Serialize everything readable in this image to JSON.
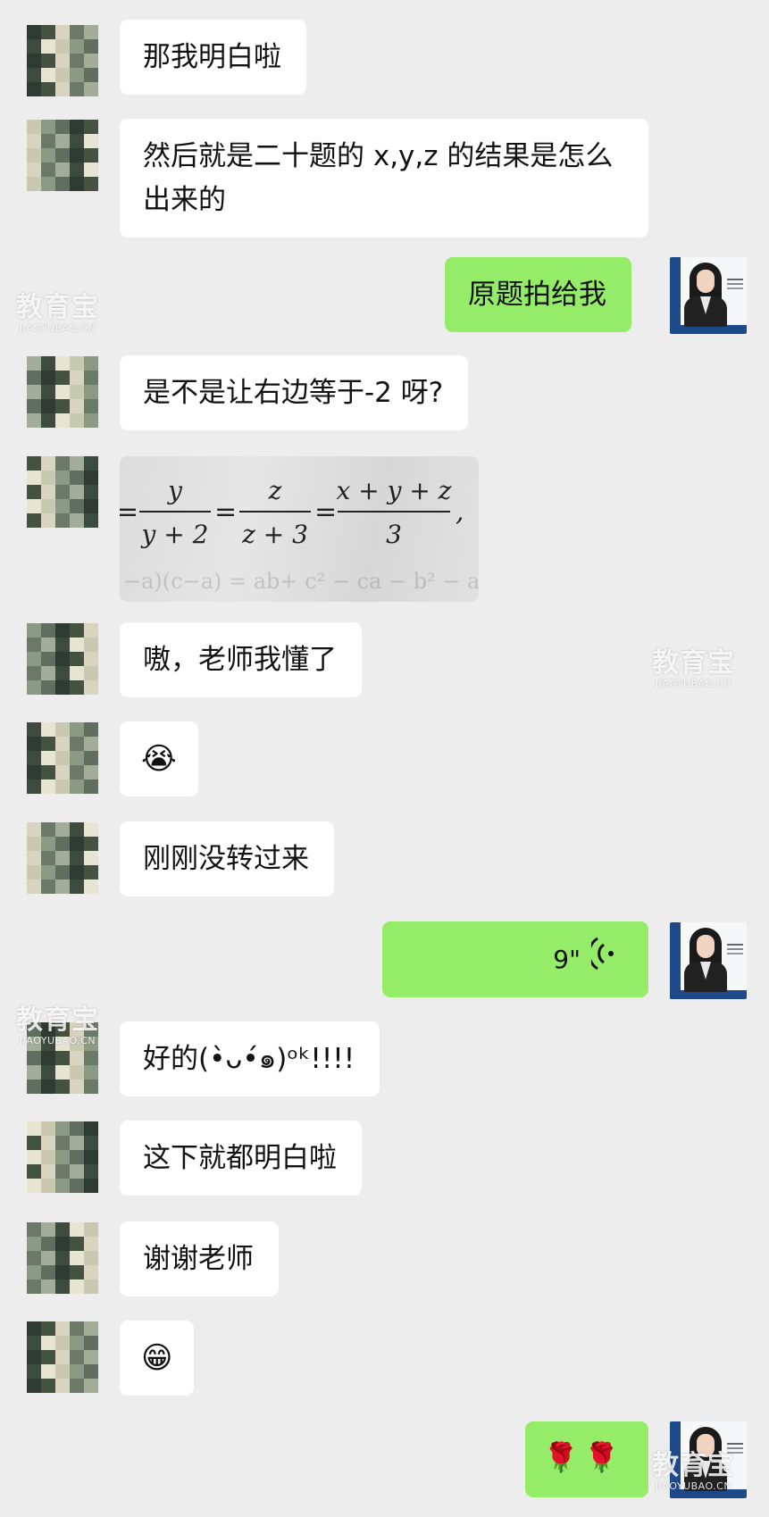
{
  "messages": [
    {
      "text": "那我明白啦"
    },
    {
      "text": "然后就是二十题的 x,y,z 的结果是怎么出来的"
    },
    {
      "text": "原题拍给我"
    },
    {
      "text": "是不是让右边等于-2 呀?"
    },
    {
      "text": "嗷，老师我懂了"
    },
    {
      "text": "😭"
    },
    {
      "text": "刚刚没转过来"
    },
    {
      "voice_duration": "9\""
    },
    {
      "text": "好的(•̀ᴗ•́๑)ᵒᵏ!!!!"
    },
    {
      "text": "这下就都明白啦"
    },
    {
      "text": "谢谢老师"
    },
    {
      "text": "😁"
    },
    {
      "text": "🌹🌹"
    }
  ],
  "math_image": {
    "frac1_num": "y",
    "frac1_den": "y + 2",
    "frac2_num": "z",
    "frac2_den": "z + 3",
    "frac3_num": "x + y + z",
    "frac3_den": "3"
  },
  "watermark": {
    "brand": "教育宝",
    "domain": "JIAOYUBAO.CN"
  },
  "colors": {
    "background": "#ededed",
    "incoming_bubble": "#ffffff",
    "outgoing_bubble": "#95ec69"
  }
}
